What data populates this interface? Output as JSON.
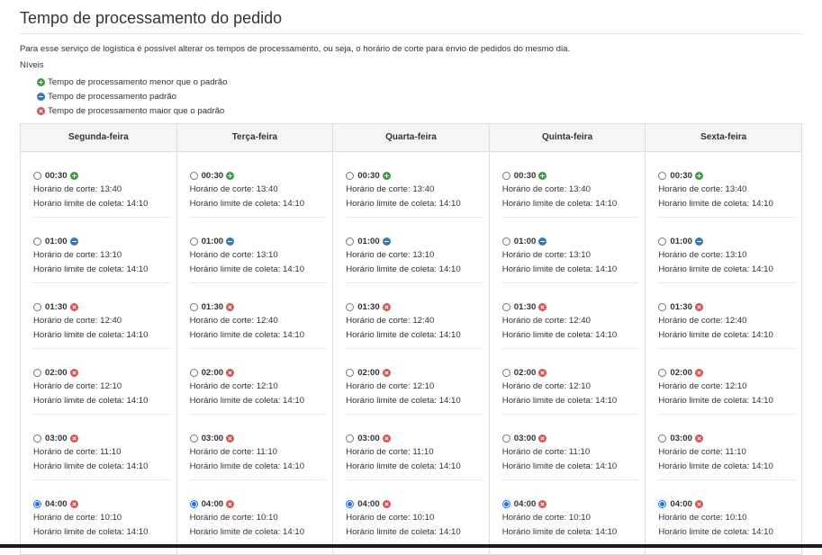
{
  "page": {
    "title": "Tempo de processamento do pedido",
    "description": "Para esse serviço de logística é possível alterar os tempos de processamento, ou seja, o horário de corte para envio de pedidos do mesmo dia.",
    "levels_title": "Níveis"
  },
  "legend": [
    {
      "icon": "plus-circle-icon",
      "color": "#3c9a3f",
      "label": "Tempo de processamento menor que o padrão"
    },
    {
      "icon": "minus-circle-icon",
      "color": "#337ab7",
      "label": "Tempo de processamento padrão"
    },
    {
      "icon": "times-circle-icon",
      "color": "#d9534f",
      "label": "Tempo de processamento maior que o padrão"
    }
  ],
  "labels": {
    "cutoff_prefix": "Horário de corte: ",
    "pickup_prefix": "Horário limite de coleta: "
  },
  "days": [
    {
      "name": "Segunda-feira",
      "options": [
        {
          "duration": "00:30",
          "level": "plus",
          "cutoff": "13:40",
          "pickup": "14:10",
          "selected": false
        },
        {
          "duration": "01:00",
          "level": "minus",
          "cutoff": "13:10",
          "pickup": "14:10",
          "selected": false
        },
        {
          "duration": "01:30",
          "level": "cross",
          "cutoff": "12:40",
          "pickup": "14:10",
          "selected": false
        },
        {
          "duration": "02:00",
          "level": "cross",
          "cutoff": "12:10",
          "pickup": "14:10",
          "selected": false
        },
        {
          "duration": "03:00",
          "level": "cross",
          "cutoff": "11:10",
          "pickup": "14:10",
          "selected": false
        },
        {
          "duration": "04:00",
          "level": "cross",
          "cutoff": "10:10",
          "pickup": "14:10",
          "selected": true
        }
      ]
    },
    {
      "name": "Terça-feira",
      "options": [
        {
          "duration": "00:30",
          "level": "plus",
          "cutoff": "13:40",
          "pickup": "14:10",
          "selected": false
        },
        {
          "duration": "01:00",
          "level": "minus",
          "cutoff": "13:10",
          "pickup": "14:10",
          "selected": false
        },
        {
          "duration": "01:30",
          "level": "cross",
          "cutoff": "12:40",
          "pickup": "14:10",
          "selected": false
        },
        {
          "duration": "02:00",
          "level": "cross",
          "cutoff": "12:10",
          "pickup": "14:10",
          "selected": false
        },
        {
          "duration": "03:00",
          "level": "cross",
          "cutoff": "11:10",
          "pickup": "14:10",
          "selected": false
        },
        {
          "duration": "04:00",
          "level": "cross",
          "cutoff": "10:10",
          "pickup": "14:10",
          "selected": true
        }
      ]
    },
    {
      "name": "Quarta-feira",
      "options": [
        {
          "duration": "00:30",
          "level": "plus",
          "cutoff": "13:40",
          "pickup": "14:10",
          "selected": false
        },
        {
          "duration": "01:00",
          "level": "minus",
          "cutoff": "13:10",
          "pickup": "14:10",
          "selected": false
        },
        {
          "duration": "01:30",
          "level": "cross",
          "cutoff": "12:40",
          "pickup": "14:10",
          "selected": false
        },
        {
          "duration": "02:00",
          "level": "cross",
          "cutoff": "12:10",
          "pickup": "14:10",
          "selected": false
        },
        {
          "duration": "03:00",
          "level": "cross",
          "cutoff": "11:10",
          "pickup": "14:10",
          "selected": false
        },
        {
          "duration": "04:00",
          "level": "cross",
          "cutoff": "10:10",
          "pickup": "14:10",
          "selected": true
        }
      ]
    },
    {
      "name": "Quinta-feira",
      "options": [
        {
          "duration": "00:30",
          "level": "plus",
          "cutoff": "13:40",
          "pickup": "14:10",
          "selected": false
        },
        {
          "duration": "01:00",
          "level": "minus",
          "cutoff": "13:10",
          "pickup": "14:10",
          "selected": false
        },
        {
          "duration": "01:30",
          "level": "cross",
          "cutoff": "12:40",
          "pickup": "14:10",
          "selected": false
        },
        {
          "duration": "02:00",
          "level": "cross",
          "cutoff": "12:10",
          "pickup": "14:10",
          "selected": false
        },
        {
          "duration": "03:00",
          "level": "cross",
          "cutoff": "11:10",
          "pickup": "14:10",
          "selected": false
        },
        {
          "duration": "04:00",
          "level": "cross",
          "cutoff": "10:10",
          "pickup": "14:10",
          "selected": true
        }
      ]
    },
    {
      "name": "Sexta-feira",
      "options": [
        {
          "duration": "00:30",
          "level": "plus",
          "cutoff": "13:40",
          "pickup": "14:10",
          "selected": false
        },
        {
          "duration": "01:00",
          "level": "minus",
          "cutoff": "13:10",
          "pickup": "14:10",
          "selected": false
        },
        {
          "duration": "01:30",
          "level": "cross",
          "cutoff": "12:40",
          "pickup": "14:10",
          "selected": false
        },
        {
          "duration": "02:00",
          "level": "cross",
          "cutoff": "12:10",
          "pickup": "14:10",
          "selected": false
        },
        {
          "duration": "03:00",
          "level": "cross",
          "cutoff": "11:10",
          "pickup": "14:10",
          "selected": false
        },
        {
          "duration": "04:00",
          "level": "cross",
          "cutoff": "10:10",
          "pickup": "14:10",
          "selected": true
        }
      ]
    }
  ]
}
